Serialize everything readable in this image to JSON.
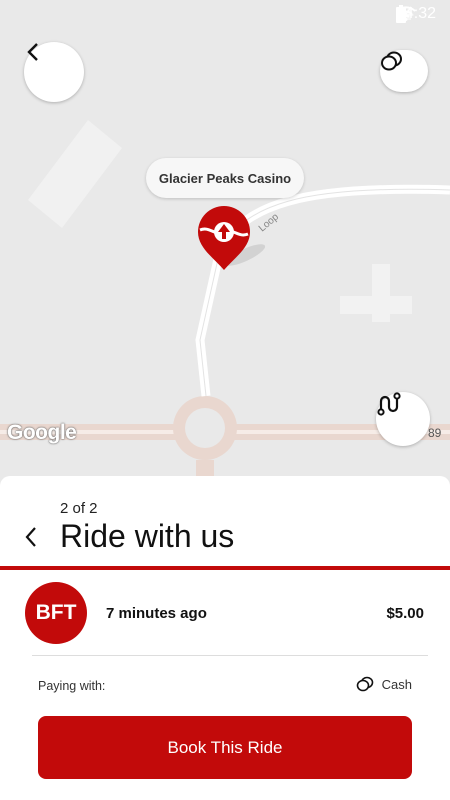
{
  "status_bar": {
    "time": "14:32"
  },
  "map": {
    "destination_label": "Glacier Peaks Casino",
    "road_label": "89",
    "street_label": "Loop",
    "attribution": "Google"
  },
  "buttons": {
    "back_icon": "chevron-left-icon",
    "payment_icon": "coins-icon",
    "route_icon": "route-icon"
  },
  "sheet": {
    "step": "2 of 2",
    "title": "Ride with us",
    "provider_initials": "BFT",
    "time_ago": "7 minutes ago",
    "price": "$5.00",
    "paying_with_label": "Paying with:",
    "payment_method": "Cash",
    "book_button_label": "Book This Ride"
  },
  "colors": {
    "accent": "#c20a0a",
    "map_bg": "#e9e9e9",
    "road": "#e9d7cf"
  }
}
